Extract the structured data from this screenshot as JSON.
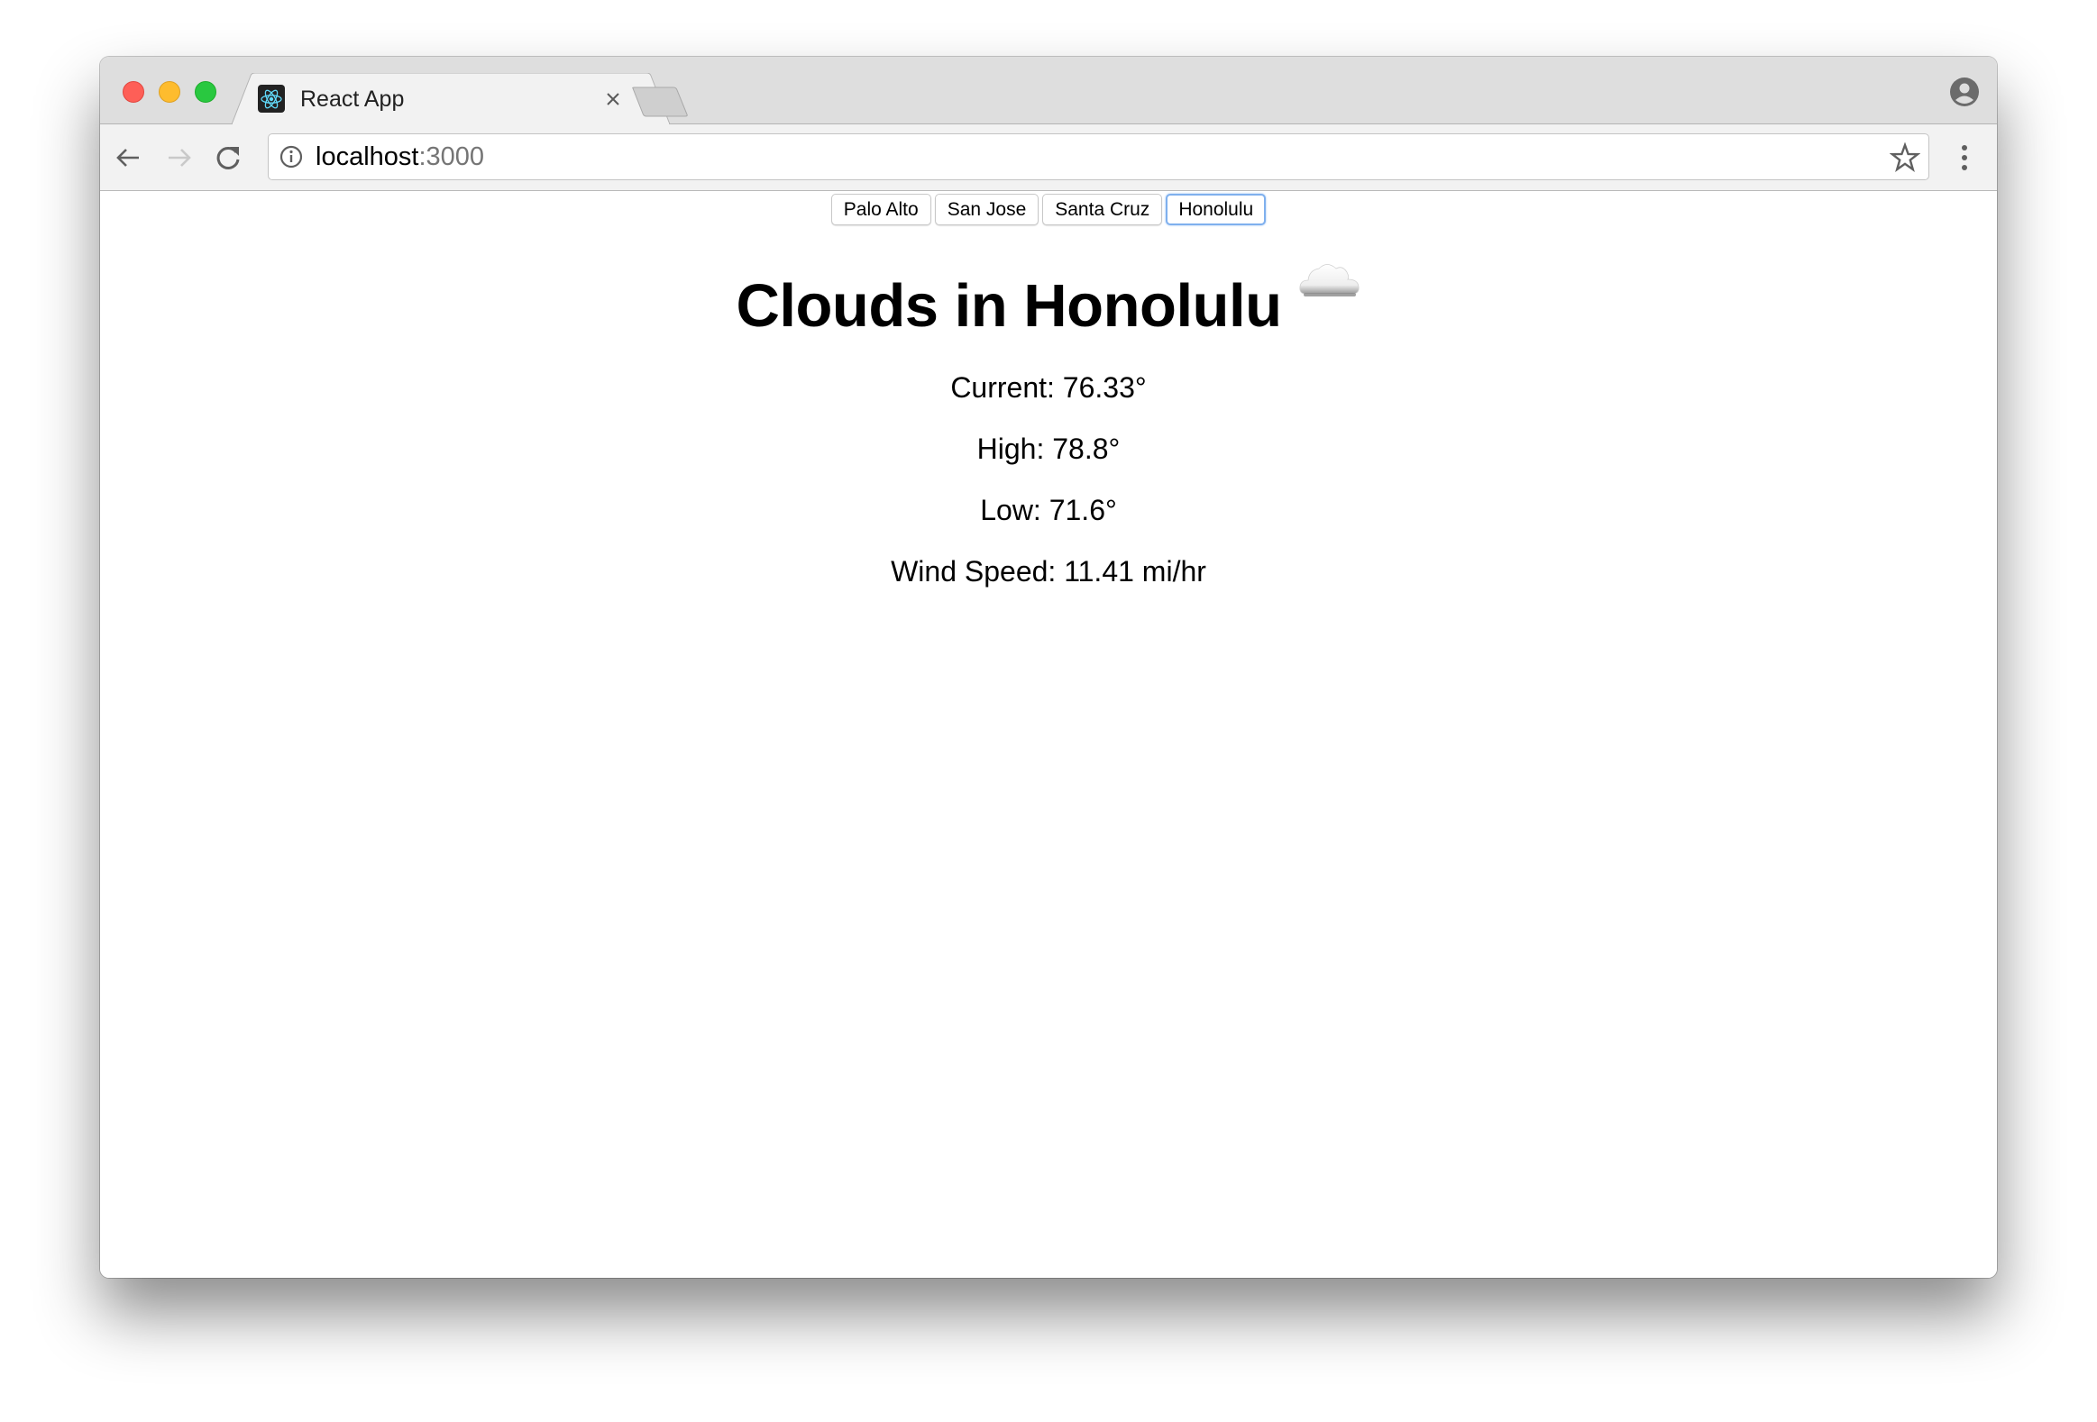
{
  "browser": {
    "tab": {
      "title": "React App",
      "favicon": "react-logo-icon"
    },
    "address_bar": {
      "host": "localhost",
      "port": ":3000"
    },
    "colors": {
      "close_light": "#fe5f57",
      "minimize_light": "#febc2e",
      "zoom_light": "#29c840",
      "react_blue": "#61dafb",
      "focus_ring": "#7fb0ee"
    }
  },
  "app": {
    "cities": [
      {
        "label": "Palo Alto",
        "active": false
      },
      {
        "label": "San Jose",
        "active": false
      },
      {
        "label": "Santa Cruz",
        "active": false
      },
      {
        "label": "Honolulu",
        "active": true
      }
    ],
    "heading": "Clouds in Honolulu",
    "weather_icon": "cloud-icon",
    "stats": {
      "current": "Current: 76.33°",
      "high": "High: 78.8°",
      "low": "Low: 71.6°",
      "wind": "Wind Speed: 11.41 mi/hr"
    }
  }
}
